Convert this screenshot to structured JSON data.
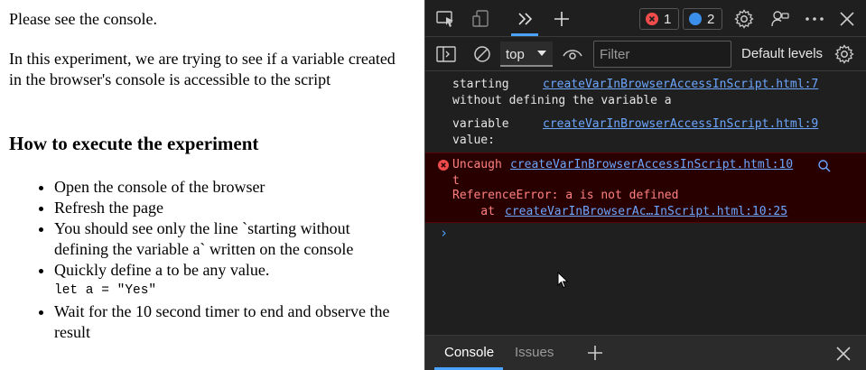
{
  "page": {
    "intro": "Please see the console.",
    "description": "In this experiment, we are trying to see if a variable created in the browser's console is accessible to the script",
    "heading": "How to execute the experiment",
    "steps": [
      "Open the console of the browser",
      "Refresh the page",
      "You should see only the line `starting without defining the variable a` written on the console",
      "Quickly define a to be any value.",
      "Wait for the 10 second timer to end and observe the result"
    ],
    "code": "let a = \"Yes\""
  },
  "devtools": {
    "error_count": "1",
    "message_count": "2",
    "context_select": "top",
    "filter_placeholder": "Filter",
    "levels_label": "Default levels",
    "messages": [
      {
        "text": "starting\nwithout defining the variable a",
        "source": "createVarInBrowserAccessInScript.html:7"
      },
      {
        "text": "variable\nvalue:",
        "source": "createVarInBrowserAccessInScript.html:9"
      }
    ],
    "error": {
      "prefix": "Uncaugh\nt",
      "source": "createVarInBrowserAccessInScript.html:10",
      "message": "ReferenceError: a is not defined",
      "stack_prefix": "    at ",
      "stack_link": "createVarInBrowserAc…InScript.html:10:25"
    },
    "prompt": "›",
    "drawer_tabs": [
      "Console",
      "Issues"
    ]
  },
  "colors": {
    "panel_bg": "#1f1f1f",
    "accent": "#4aa3ff",
    "link": "#6ca6ff",
    "error_bg": "#290000",
    "error_text": "#ff8080"
  }
}
